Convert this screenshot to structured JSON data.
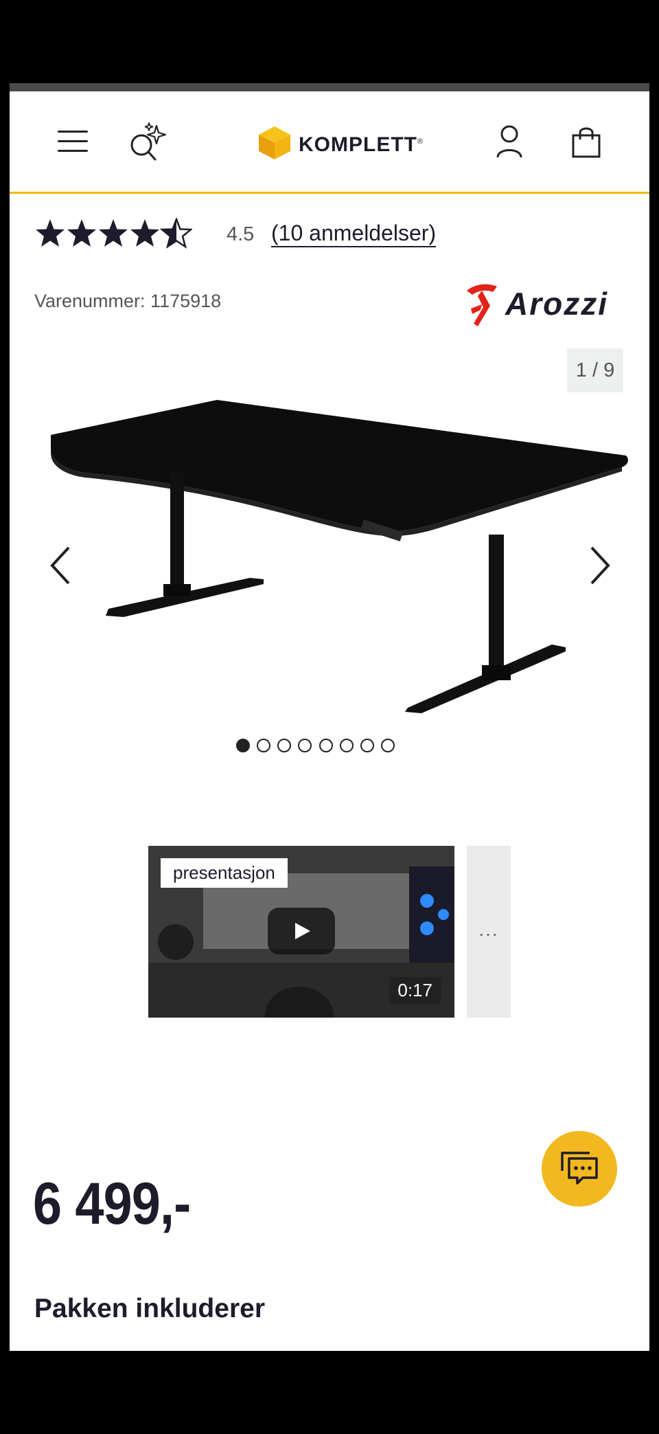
{
  "header": {
    "logo_text": "KOMPLETT",
    "logo_mark": "®",
    "icons": [
      "menu-icon",
      "ai-search-icon",
      "account-icon",
      "cart-icon"
    ],
    "accent_color": "#f2b705"
  },
  "product": {
    "rating_value": "4.5",
    "rating_stars": 4.5,
    "reviews_link": "(10 anmeldelser)",
    "sku_text": "Varenummer: 1175918",
    "brand": "Arozzi",
    "price": "6 499,-"
  },
  "gallery": {
    "counter": "1 / 9",
    "image_count": 8,
    "active_index": 0
  },
  "video": {
    "tag": "presentasjon",
    "duration": "0:17",
    "more_label": "..."
  },
  "sections": {
    "package_title": "Pakken inkluderer"
  },
  "colors": {
    "chat_button": "#f3b81f",
    "text_dark": "#1c1c2b",
    "brand_red": "#e2231a"
  }
}
